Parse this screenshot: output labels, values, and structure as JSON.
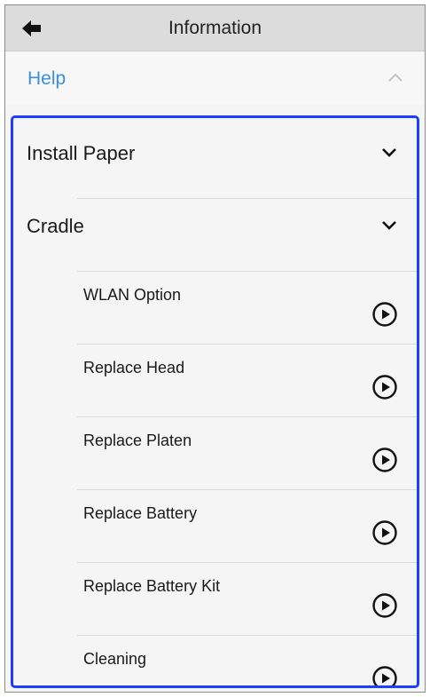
{
  "header": {
    "title": "Information",
    "back_icon": "back-arrow-icon"
  },
  "help": {
    "label": "Help",
    "state": "expanded",
    "color": "#3b8fd9"
  },
  "sections": [
    {
      "label": "Install Paper",
      "icon": "chevron-down-icon"
    },
    {
      "label": "Cradle",
      "icon": "chevron-down-icon"
    }
  ],
  "items": [
    {
      "label": "WLAN Option",
      "icon": "play-circle-icon"
    },
    {
      "label": "Replace Head",
      "icon": "play-circle-icon"
    },
    {
      "label": "Replace Platen",
      "icon": "play-circle-icon"
    },
    {
      "label": "Replace Battery",
      "icon": "play-circle-icon"
    },
    {
      "label": "Replace Battery Kit",
      "icon": "play-circle-icon"
    },
    {
      "label": "Cleaning",
      "icon": "play-circle-icon"
    }
  ],
  "highlight_color": "#1f3dff"
}
